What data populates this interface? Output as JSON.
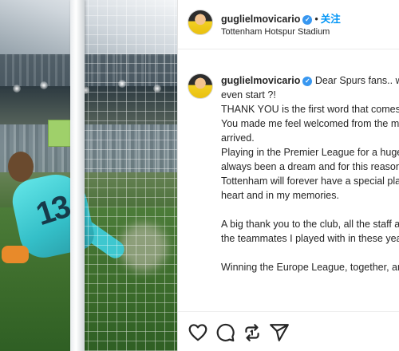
{
  "post": {
    "username": "guglielmovicario",
    "separator": "•",
    "follow_label": "关注",
    "location": "Tottenham Hotspur Stadium"
  },
  "photo": {
    "shirt_number": "13"
  },
  "caption": {
    "first_line": "Dear Spurs fans.. wh",
    "lines": [
      "even start ?!",
      "THANK YOU is the first word that comes",
      "You made me feel welcomed from the m",
      "arrived.",
      "Playing in the Premier League for a huge",
      "always been a dream and for this reason",
      "Tottenham will forever have a special pla",
      "heart and in my memories.",
      "",
      "A big thank you to the club, all the staff a",
      "the teammates I played with in these yea",
      "",
      "Winning the Europe League, together, an"
    ]
  },
  "actions": {
    "icons": [
      "heart-icon",
      "comment-icon",
      "repost-icon",
      "share-icon"
    ]
  },
  "colors": {
    "accent": "#0095f6",
    "verified": "#3897f0",
    "text": "#262626",
    "jersey": "#3ec7cf"
  }
}
